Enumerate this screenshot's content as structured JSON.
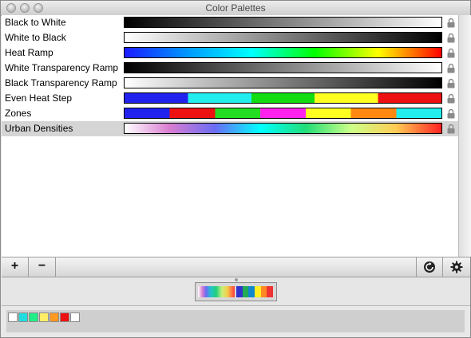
{
  "window": {
    "title": "Color Palettes"
  },
  "palettes": [
    {
      "name": "Black to White",
      "selected": false,
      "locked": true,
      "gradient": [
        "#000000",
        "#ffffff"
      ]
    },
    {
      "name": "White to Black",
      "selected": false,
      "locked": true,
      "gradient": [
        "#ffffff",
        "#000000"
      ]
    },
    {
      "name": "Heat Ramp",
      "selected": false,
      "locked": true,
      "gradient": [
        "#1a1aff",
        "#0099ff",
        "#00ffff",
        "#00ff00",
        "#ffff00",
        "#ff0000"
      ]
    },
    {
      "name": "White Transparency Ramp",
      "selected": false,
      "locked": true,
      "gradient": [
        "#000000",
        "#ffffff"
      ]
    },
    {
      "name": "Black Transparency Ramp",
      "selected": false,
      "locked": true,
      "gradient": [
        "#ffffff",
        "#000000"
      ]
    },
    {
      "name": "Even Heat Step",
      "selected": false,
      "locked": true,
      "steps": [
        "#2222ee",
        "#22eeee",
        "#11dd11",
        "#ffff22",
        "#ee1111"
      ]
    },
    {
      "name": "Zones",
      "selected": false,
      "locked": true,
      "steps": [
        "#2222ee",
        "#ee1111",
        "#22dd22",
        "#ff22ee",
        "#ffff22",
        "#ff8811",
        "#22eeee"
      ]
    },
    {
      "name": "Urban Densities",
      "selected": true,
      "locked": true,
      "gradient": [
        "#ffffff",
        "#d87dd0",
        "#6a6cf5",
        "#00ffff",
        "#22dd77",
        "#ccff88",
        "#ffcc55",
        "#ff2222"
      ]
    }
  ],
  "toolbar": {
    "add_label": "+",
    "remove_label": "−",
    "refresh_icon": "refresh-icon",
    "gear_icon": "gear-icon"
  },
  "preview": {
    "steps": [
      "#3333cc",
      "#22aa55",
      "#1188cc",
      "#ffee22",
      "#ff8822",
      "#ee3333"
    ]
  },
  "swatches": [
    "#ffffff",
    "#22dddd",
    "#22ee88",
    "#ffee66",
    "#ff9922",
    "#ee1111",
    "#ffffff"
  ]
}
